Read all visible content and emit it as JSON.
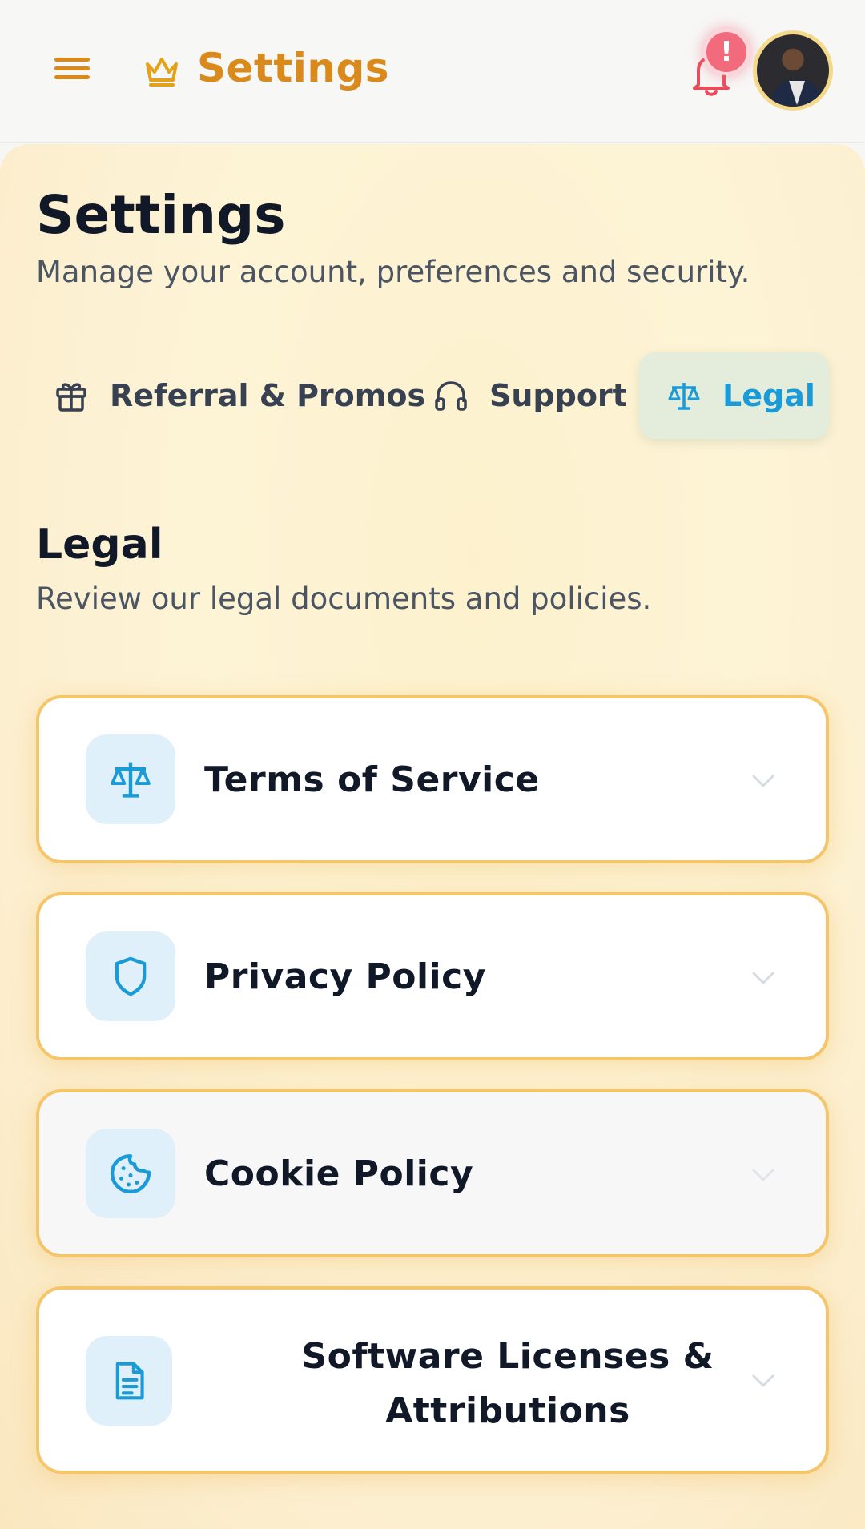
{
  "header": {
    "title": "Settings",
    "alert_badge": "!",
    "icons": {
      "menu": "hamburger-menu-icon",
      "brand": "crown-icon",
      "notifications": "bell-icon"
    }
  },
  "page": {
    "title": "Settings",
    "subtitle": "Manage your account, preferences and security."
  },
  "tabs": [
    {
      "label": "Referral & Promos",
      "icon": "gift-icon",
      "active": false
    },
    {
      "label": "Support",
      "icon": "headphones-icon",
      "active": false
    },
    {
      "label": "Legal",
      "icon": "scale-icon",
      "active": true
    }
  ],
  "legal": {
    "title": "Legal",
    "subtitle": "Review our legal documents and policies.",
    "items": [
      {
        "label": "Terms of Service",
        "icon": "scale-icon"
      },
      {
        "label": "Privacy Policy",
        "icon": "shield-icon"
      },
      {
        "label": "Cookie Policy",
        "icon": "cookie-icon"
      },
      {
        "label": "Software Licenses & Attributions",
        "icon": "document-icon"
      }
    ]
  },
  "colors": {
    "accent": "#d98a1a",
    "active_tab_text": "#1a9bd8",
    "card_border": "#f5c56a",
    "alert": "#f26b7d"
  }
}
